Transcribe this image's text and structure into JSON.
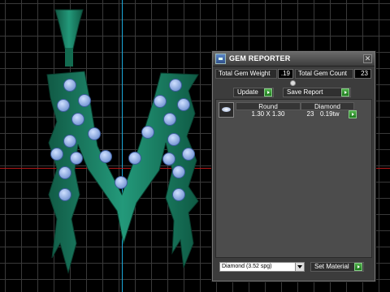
{
  "panel": {
    "title": "GEM REPORTER",
    "close_glyph": "✕",
    "total_weight_label": "Total Gem Weight",
    "total_weight_value": ".19",
    "total_count_label": "Total Gem Count",
    "total_count_value": "23",
    "update_label": "Update",
    "save_report_label": "Save Report",
    "table": {
      "headers": [
        "Round",
        "Diamond"
      ],
      "row": {
        "size": "1.30 X 1.30",
        "count": "23",
        "weight": "0.19tw"
      }
    },
    "material_select": {
      "value": "Diamond  (3.52 spg)"
    },
    "set_material_label": "Set Material"
  },
  "colors": {
    "model_green": "#1e8c6a",
    "gem_blue": "#8faedf",
    "axis_blue": "#1aa7d8",
    "axis_red": "#b01818",
    "go_green": "#2e9a2e"
  },
  "icons": [
    "gem-reporter-app-icon",
    "close-icon",
    "go-arrow-icon",
    "round-gem-icon",
    "dropdown-arrow-icon"
  ]
}
